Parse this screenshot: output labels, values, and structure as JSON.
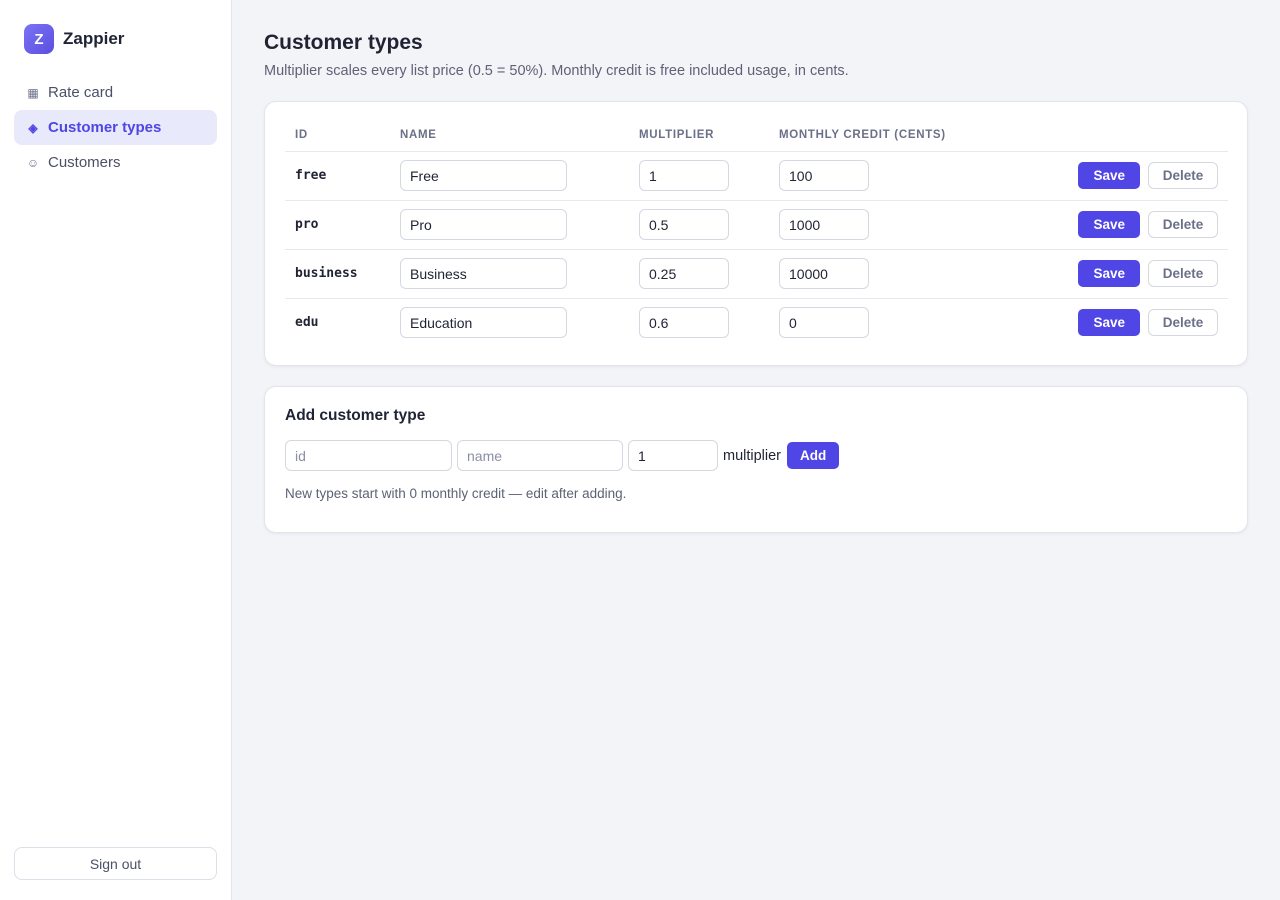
{
  "app": {
    "logo_letter": "Z",
    "name": "Zappier"
  },
  "sidebar": {
    "items": [
      {
        "icon": "grid-icon",
        "glyph": "▦",
        "label": "Rate card",
        "active": false
      },
      {
        "icon": "diamond-icon",
        "glyph": "◈",
        "label": "Customer types",
        "active": true
      },
      {
        "icon": "smiley-icon",
        "glyph": "☺",
        "label": "Customers",
        "active": false
      }
    ],
    "sign_out": "Sign out"
  },
  "page": {
    "title": "Customer types",
    "subtitle": "Multiplier scales every list price (0.5 = 50%). Monthly credit is free included usage, in cents."
  },
  "table": {
    "headers": {
      "id": "ID",
      "name": "Name",
      "multiplier": "Multiplier",
      "credit": "Monthly credit (cents)"
    },
    "rows": [
      {
        "id": "free",
        "name": "Free",
        "multiplier": "1",
        "credit": "100"
      },
      {
        "id": "pro",
        "name": "Pro",
        "multiplier": "0.5",
        "credit": "1000"
      },
      {
        "id": "business",
        "name": "Business",
        "multiplier": "0.25",
        "credit": "10000"
      },
      {
        "id": "edu",
        "name": "Education",
        "multiplier": "0.6",
        "credit": "0"
      }
    ],
    "save_label": "Save",
    "delete_label": "Delete"
  },
  "add_form": {
    "title": "Add customer type",
    "id_placeholder": "id",
    "name_placeholder": "name",
    "multiplier_value": "1",
    "multiplier_label": "multiplier",
    "add_label": "Add",
    "note": "New types start with 0 monthly credit — edit after adding."
  },
  "colors": {
    "accent": "#4f46e5",
    "active_bg": "#e8e9fb",
    "page_bg": "#f3f4f8"
  }
}
